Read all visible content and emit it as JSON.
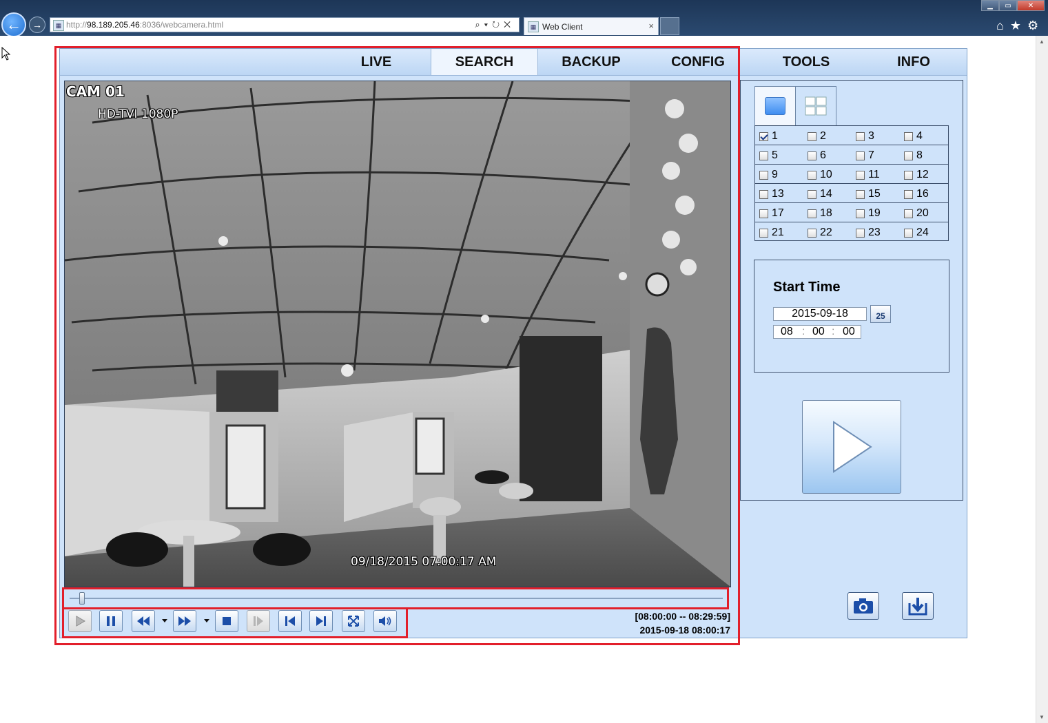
{
  "browser": {
    "url_prefix": "http://",
    "url_host": "98.189.205.46",
    "url_rest": ":8036/webcamera.html",
    "address_controls": "⌕▾↻✕",
    "tab_title": "Web Client",
    "tab_close": "×",
    "window_controls": {
      "minimize": "▁",
      "maximize": "▭",
      "close": "✕"
    },
    "toolbar_icons": {
      "home": "⌂",
      "favorites": "★",
      "settings": "⚙"
    }
  },
  "menu": {
    "items": [
      {
        "label": "LIVE",
        "active": false
      },
      {
        "label": "SEARCH",
        "active": true
      },
      {
        "label": "BACKUP",
        "active": false
      },
      {
        "label": "CONFIG",
        "active": false
      },
      {
        "label": "TOOLS",
        "active": false
      },
      {
        "label": "INFO",
        "active": false
      }
    ]
  },
  "video": {
    "camera": "CAM 01",
    "resolution": "HD-TVI 1080P",
    "osd_timestamp": "09/18/2015 07:00:17 AM"
  },
  "playback": {
    "seek_fraction": 0.015,
    "time_range": "[08:00:00 -- 08:29:59]",
    "current_time": "2015-09-18 08:00:17",
    "buttons": [
      "play",
      "pause",
      "rewind",
      "fast-forward",
      "stop",
      "step-frame",
      "skip-start",
      "skip-end",
      "fullscreen",
      "volume"
    ]
  },
  "channels": {
    "layout_options": [
      "single",
      "quad"
    ],
    "selected_layout": "single",
    "list": [
      {
        "num": "1",
        "checked": true
      },
      {
        "num": "2",
        "checked": false
      },
      {
        "num": "3",
        "checked": false
      },
      {
        "num": "4",
        "checked": false
      },
      {
        "num": "5",
        "checked": false
      },
      {
        "num": "6",
        "checked": false
      },
      {
        "num": "7",
        "checked": false
      },
      {
        "num": "8",
        "checked": false
      },
      {
        "num": "9",
        "checked": false
      },
      {
        "num": "10",
        "checked": false
      },
      {
        "num": "11",
        "checked": false
      },
      {
        "num": "12",
        "checked": false
      },
      {
        "num": "13",
        "checked": false
      },
      {
        "num": "14",
        "checked": false
      },
      {
        "num": "15",
        "checked": false
      },
      {
        "num": "16",
        "checked": false
      },
      {
        "num": "17",
        "checked": false
      },
      {
        "num": "18",
        "checked": false
      },
      {
        "num": "19",
        "checked": false
      },
      {
        "num": "20",
        "checked": false
      },
      {
        "num": "21",
        "checked": false
      },
      {
        "num": "22",
        "checked": false
      },
      {
        "num": "23",
        "checked": false
      },
      {
        "num": "24",
        "checked": false
      }
    ]
  },
  "start_time": {
    "title": "Start Time",
    "date": "2015-09-18",
    "calendar_day": "25",
    "hour": "08",
    "minute": "00",
    "second": "00",
    "sep": ":"
  },
  "colors": {
    "annotation_red": "#e21f2b",
    "panel_bg": "#cfe3fa",
    "menu_active": "#eef5fe"
  }
}
